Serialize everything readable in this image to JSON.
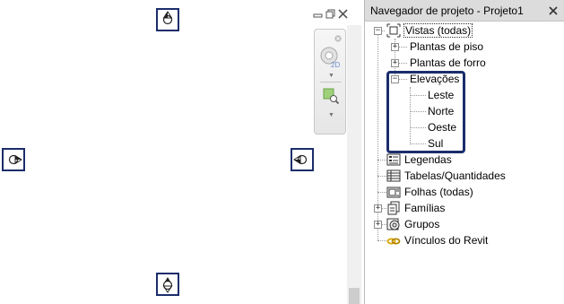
{
  "browser": {
    "title": "Navegador de projeto - Projeto1",
    "tree": [
      {
        "label": "Vistas (todas)",
        "icon": "views-icon",
        "expanded": true,
        "selected": true
      },
      {
        "label": "Plantas de piso",
        "expanded": false
      },
      {
        "label": "Plantas de forro",
        "expanded": false
      },
      {
        "label": "Elevações",
        "expanded": true
      },
      {
        "label": "Leste"
      },
      {
        "label": "Norte"
      },
      {
        "label": "Oeste"
      },
      {
        "label": "Sul"
      },
      {
        "label": "Legendas",
        "icon": "legends-icon"
      },
      {
        "label": "Tabelas/Quantidades",
        "icon": "schedules-icon"
      },
      {
        "label": "Folhas (todas)",
        "icon": "sheets-icon"
      },
      {
        "label": "Famílias",
        "icon": "families-icon",
        "expanded": false
      },
      {
        "label": "Grupos",
        "icon": "groups-icon",
        "expanded": false
      },
      {
        "label": "Vínculos do Revit",
        "icon": "revit-links-icon"
      }
    ]
  },
  "canvas": {
    "markers": [
      "north-elevation-marker-icon",
      "west-elevation-marker-icon",
      "east-elevation-marker-icon",
      "south-elevation-marker-icon"
    ],
    "navbar": {
      "wheel_label": "2D"
    }
  },
  "colors": {
    "highlight": "#1b2d6b",
    "links": "#d9a400"
  }
}
